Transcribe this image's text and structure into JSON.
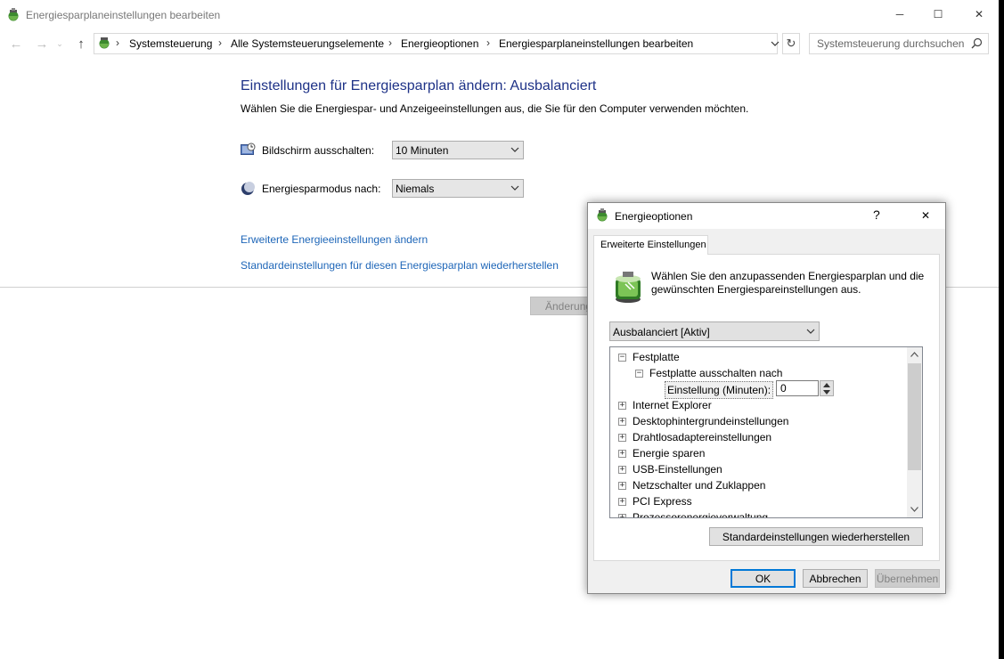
{
  "window": {
    "title": "Energiesparplaneinstellungen bearbeiten",
    "minimize": "─",
    "maximize": "☐",
    "close": "✕"
  },
  "address_bar": {
    "breadcrumbs": [
      "Systemsteuerung",
      "Alle Systemsteuerungselemente",
      "Energieoptionen",
      "Energiesparplaneinstellungen bearbeiten"
    ],
    "separator": "›"
  },
  "search": {
    "placeholder": "Systemsteuerung durchsuchen"
  },
  "main": {
    "heading": "Einstellungen für Energiesparplan ändern: Ausbalanciert",
    "description": "Wählen Sie die Energiespar- und Anzeigeeinstellungen aus, die Sie für den Computer verwenden möchten.",
    "display_off_label": "Bildschirm ausschalten:",
    "display_off_value": "10 Minuten",
    "sleep_label": "Energiesparmodus nach:",
    "sleep_value": "Niemals",
    "advanced_link": "Erweiterte Energieeinstellungen ändern",
    "restore_link": "Standardeinstellungen für diesen Energiesparplan wiederherstellen",
    "save_button": "Änderungen speichern"
  },
  "dialog": {
    "title": "Energieoptionen",
    "help": "?",
    "close": "✕",
    "tab": "Erweiterte Einstellungen",
    "description": "Wählen Sie den anzupassenden Energiesparplan und die gewünschten Energiespareinstellungen aus.",
    "plan_value": "Ausbalanciert [Aktiv]",
    "tree": {
      "festplatte": "Festplatte",
      "festplatte_off": "Festplatte ausschalten nach",
      "setting_label": "Einstellung (Minuten):",
      "setting_value": "0",
      "items": [
        "Internet Explorer",
        "Desktophintergrundeinstellungen",
        "Drahtlosadaptereinstellungen",
        "Energie sparen",
        "USB-Einstellungen",
        "Netzschalter und Zuklappen",
        "PCI Express",
        "Prozessorenergieverwaltung"
      ]
    },
    "restore_button": "Standardeinstellungen wiederherstellen",
    "ok_button": "OK",
    "cancel_button": "Abbrechen",
    "apply_button": "Übernehmen"
  },
  "colors": {
    "heading": "#1e3287",
    "link": "#1e66b8",
    "accent": "#0078d7"
  }
}
